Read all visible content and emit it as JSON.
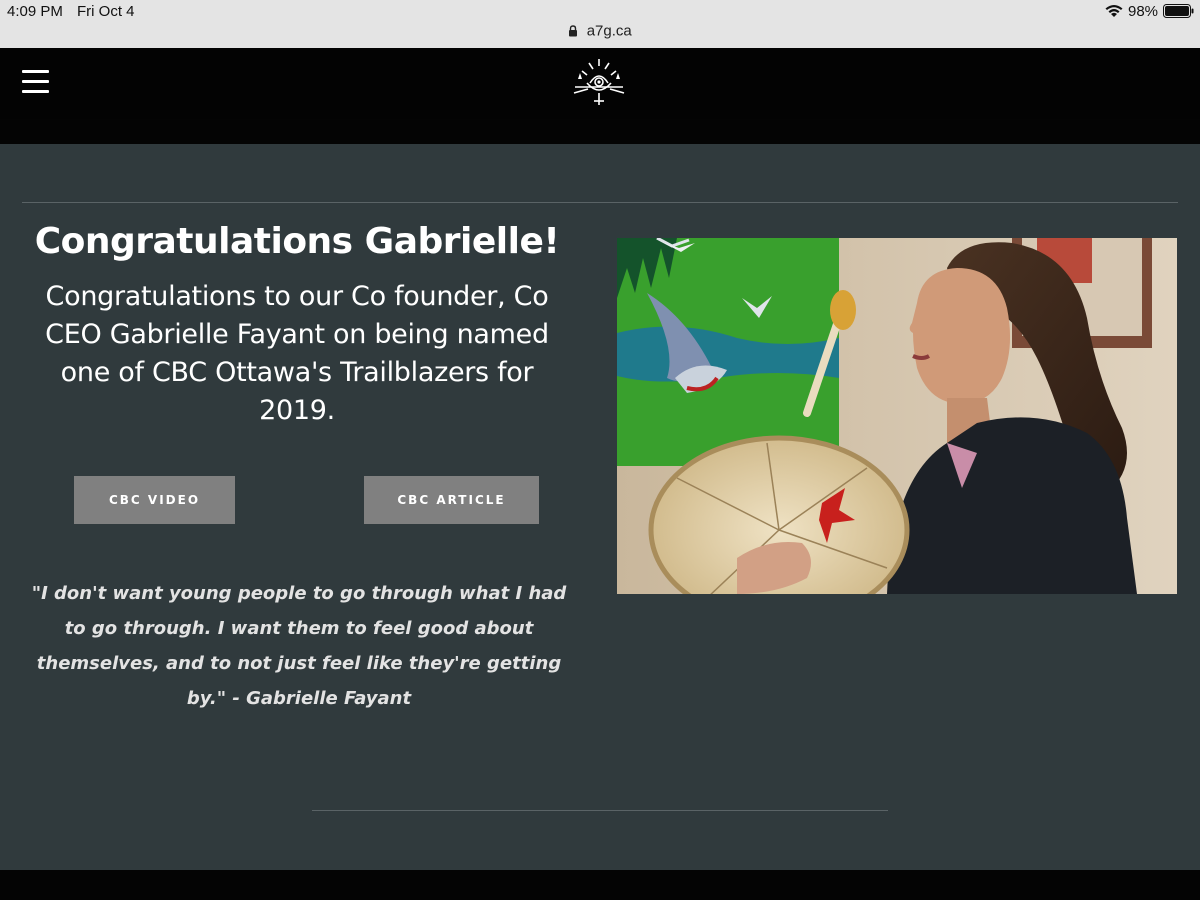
{
  "status_bar": {
    "time": "4:09 PM",
    "date": "Fri Oct 4",
    "battery": "98%",
    "url": "a7g.ca"
  },
  "main": {
    "headline": "Congratulations Gabrielle!",
    "intro": "Congratulations to our Co founder, Co CEO Gabrielle Fayant on being named one of CBC Ottawa's Trailblazers for 2019.",
    "buttons": {
      "video": "CBC VIDEO",
      "article": "CBC ARTICLE"
    },
    "quote": "\"I don't want young people to go through what I had to go through. I want them to feel good about themselves, and to not just feel like they're getting by.\" - Gabrielle Fayant"
  },
  "colors": {
    "background": "#303a3d",
    "header": "#030303",
    "button": "#808080"
  },
  "icons": [
    "lock-icon",
    "wifi-icon",
    "battery-icon",
    "menu-icon",
    "site-logo"
  ]
}
